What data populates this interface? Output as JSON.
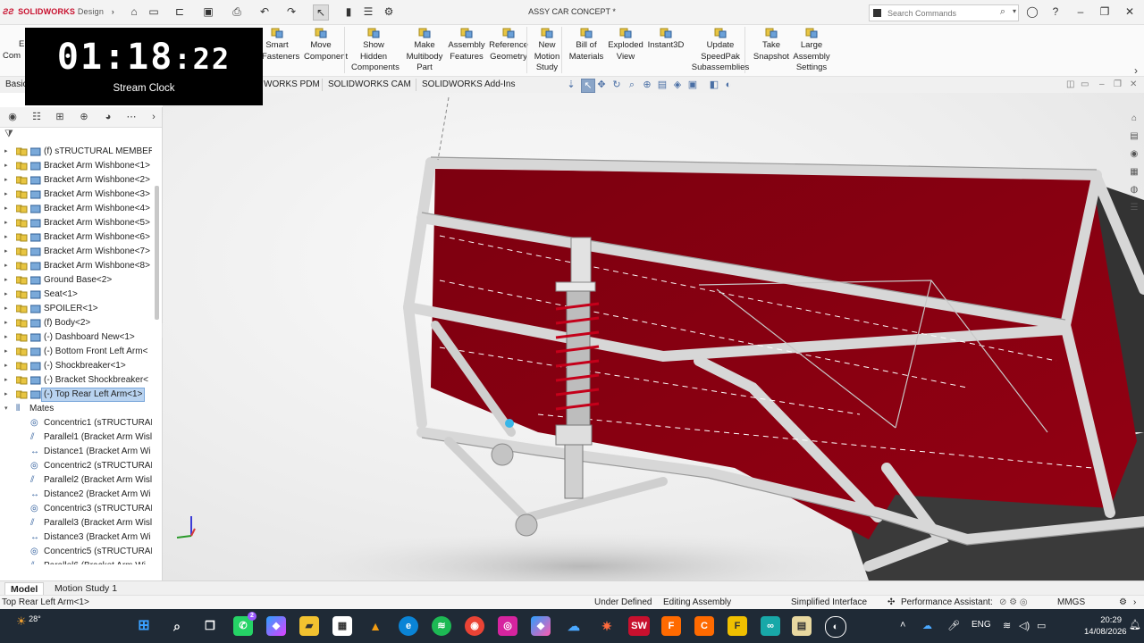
{
  "app": {
    "logo_brand": "SOLIDWORKS",
    "logo_suffix": "Design",
    "document_title": "ASSY CAR CONCEPT *",
    "search_placeholder": "Search Commands"
  },
  "ribbon": {
    "left_partial": [
      "E",
      "Com"
    ],
    "buttons": [
      {
        "label": "Smart Fasteners",
        "lines": [
          "Smart",
          "Fasteners"
        ],
        "icon": "fastener-icon"
      },
      {
        "label": "Move Component",
        "lines": [
          "Move",
          "Component"
        ],
        "icon": "move-component-icon"
      },
      {
        "label": "Show Hidden Components",
        "lines": [
          "Show",
          "Hidden",
          "Components"
        ],
        "icon": "show-hidden-icon"
      },
      {
        "label": "Make Multibody Part",
        "lines": [
          "Make",
          "Multibody",
          "Part"
        ],
        "icon": "multibody-icon"
      },
      {
        "label": "Assembly Features",
        "lines": [
          "Assembly",
          "Features"
        ],
        "icon": "assembly-features-icon"
      },
      {
        "label": "Reference Geometry",
        "lines": [
          "Reference",
          "Geometry"
        ],
        "icon": "reference-geometry-icon"
      },
      {
        "label": "New Motion Study",
        "lines": [
          "New",
          "Motion",
          "Study"
        ],
        "icon": "motion-study-icon"
      },
      {
        "label": "Bill of Materials",
        "lines": [
          "Bill of",
          "Materials"
        ],
        "icon": "bom-icon"
      },
      {
        "label": "Exploded View",
        "lines": [
          "Exploded",
          "View"
        ],
        "icon": "exploded-view-icon"
      },
      {
        "label": "Instant3D",
        "lines": [
          "Instant3D"
        ],
        "icon": "instant3d-icon"
      },
      {
        "label": "Update SpeedPak Subassemblies",
        "lines": [
          "Update",
          "SpeedPak",
          "Subassemblies"
        ],
        "icon": "speedpak-icon"
      },
      {
        "label": "Take Snapshot",
        "lines": [
          "Take",
          "Snapshot"
        ],
        "icon": "snapshot-icon"
      },
      {
        "label": "Large Assembly Settings",
        "lines": [
          "Large",
          "Assembly",
          "Settings"
        ],
        "icon": "large-assembly-icon"
      }
    ]
  },
  "tabs": {
    "first_partial": "Basic",
    "items": [
      "SOLIDWORKS PDM",
      "SOLIDWORKS CAM",
      "SOLIDWORKS Add-Ins"
    ],
    "pdm_visible": "WORKS PDM"
  },
  "overlay": {
    "time_main": "01:18",
    "time_seconds": ":22",
    "label": "Stream Clock"
  },
  "tree": {
    "components": [
      {
        "label": "(f) sTRUCTURAL MEMBER<"
      },
      {
        "label": "Bracket Arm Wishbone<1>"
      },
      {
        "label": "Bracket Arm Wishbone<2>"
      },
      {
        "label": "Bracket Arm Wishbone<3>"
      },
      {
        "label": "Bracket Arm Wishbone<4>"
      },
      {
        "label": "Bracket Arm Wishbone<5>"
      },
      {
        "label": "Bracket Arm Wishbone<6>"
      },
      {
        "label": "Bracket Arm Wishbone<7>"
      },
      {
        "label": "Bracket Arm Wishbone<8>"
      },
      {
        "label": "Ground Base<2>"
      },
      {
        "label": "Seat<1>"
      },
      {
        "label": "SPOILER<1>"
      },
      {
        "label": "(f) Body<2>"
      },
      {
        "label": "(-) Dashboard New<1>"
      },
      {
        "label": "(-) Bottom Front Left Arm<"
      },
      {
        "label": "(-) Shockbreaker<1>"
      },
      {
        "label": "(-) Bracket Shockbreaker<"
      },
      {
        "label": "(-) Top Rear Left Arm<1>",
        "selected": true
      }
    ],
    "mates_label": "Mates",
    "mates": [
      {
        "label": "Concentric1 (sTRUCTURAL",
        "type": "concentric"
      },
      {
        "label": "Parallel1 (Bracket Arm Wisl",
        "type": "parallel"
      },
      {
        "label": "Distance1 (Bracket Arm Wi",
        "type": "distance"
      },
      {
        "label": "Concentric2 (sTRUCTURAL",
        "type": "concentric"
      },
      {
        "label": "Parallel2 (Bracket Arm Wisl",
        "type": "parallel"
      },
      {
        "label": "Distance2 (Bracket Arm Wi",
        "type": "distance"
      },
      {
        "label": "Concentric3 (sTRUCTURAL",
        "type": "concentric"
      },
      {
        "label": "Parallel3 (Bracket Arm Wisl",
        "type": "parallel"
      },
      {
        "label": "Distance3 (Bracket Arm Wi",
        "type": "distance"
      },
      {
        "label": "Concentric5 (sTRUCTURAL",
        "type": "concentric"
      },
      {
        "label": "Parallel6 (Bracket Arm Wi",
        "type": "parallel"
      }
    ]
  },
  "model_tabs": {
    "model": "Model",
    "motion": "Motion Study 1"
  },
  "status": {
    "selection": "Top Rear Left Arm<1>",
    "definition": "Under Defined",
    "mode": "Editing Assembly",
    "interface": "Simplified Interface",
    "assistant": "Performance Assistant:",
    "units": "MMGS"
  },
  "taskbar": {
    "weather": "28°",
    "lang": "ENG",
    "time": "20:29",
    "date": "14/08/2026",
    "whatsapp_badge": "2"
  },
  "colors": {
    "body_red": "#8b0010",
    "frame_grey": "#d9d9d9",
    "selection_blue": "#b9d3f0",
    "taskbar": "#1f2a36"
  }
}
